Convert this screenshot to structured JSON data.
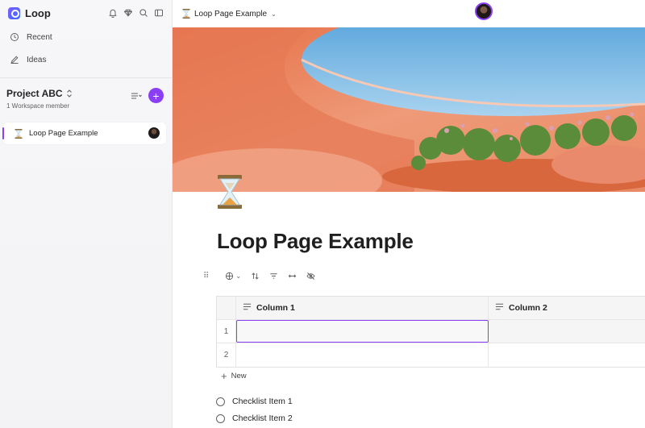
{
  "app": {
    "name": "Loop"
  },
  "sidebar": {
    "nav": [
      {
        "label": "Recent",
        "icon": "clock-icon"
      },
      {
        "label": "Ideas",
        "icon": "pencil-note-icon"
      }
    ],
    "workspace": {
      "title": "Project ABC",
      "members": "1 Workspace member"
    },
    "pages": [
      {
        "title": "Loop Page Example",
        "emoji": "hourglass-icon"
      }
    ]
  },
  "topbar": {
    "page_title": "Loop Page Example"
  },
  "page": {
    "title": "Loop Page Example",
    "emoji": "hourglass-icon"
  },
  "table": {
    "columns": [
      "Column 1",
      "Column 2"
    ],
    "rows": [
      {
        "num": "1",
        "cells": [
          "",
          ""
        ]
      },
      {
        "num": "2",
        "cells": [
          "",
          ""
        ]
      }
    ],
    "new_label": "New"
  },
  "checklist": [
    {
      "label": "Checklist Item 1",
      "checked": false
    },
    {
      "label": "Checklist Item 2",
      "checked": false
    }
  ],
  "colors": {
    "accent": "#8a3ff5",
    "cover_orange": "#e97c55",
    "sky": "#5ba7de"
  }
}
